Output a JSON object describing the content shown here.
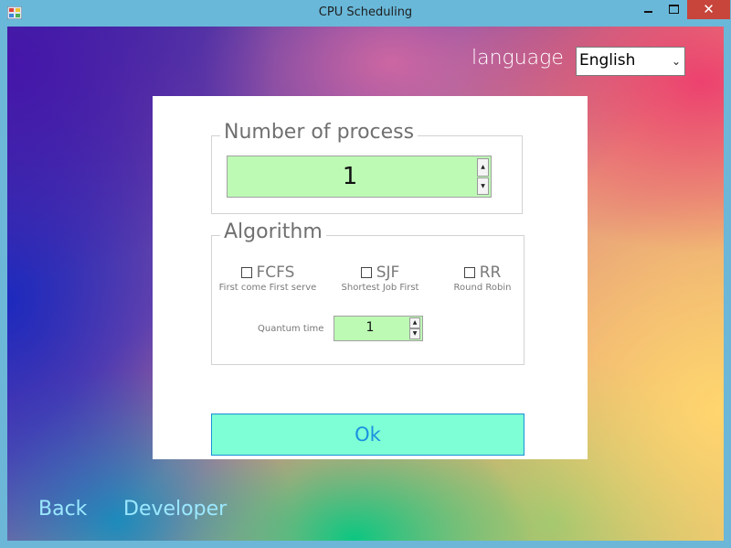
{
  "window": {
    "title": "CPU Scheduling",
    "close_glyph": "✕"
  },
  "language": {
    "label": "language",
    "selected": "English",
    "chevron": "⌄"
  },
  "process_group": {
    "legend": "Number of process",
    "value": "1"
  },
  "algorithm_group": {
    "legend": "Algorithm",
    "options": [
      {
        "name": "FCFS",
        "description": "First come First serve",
        "checked": false
      },
      {
        "name": "SJF",
        "description": "Shortest Job First",
        "checked": false
      },
      {
        "name": "RR",
        "description": "Round Robin",
        "checked": false
      }
    ],
    "quantum_label": "Quantum time",
    "quantum_value": "1"
  },
  "ok_label": "Ok",
  "footer": {
    "back_label": "Back",
    "developer_label": "Developer"
  },
  "colors": {
    "input_bg": "#bdfbb5",
    "ok_bg": "#7effd6",
    "ok_text": "#1a90e0",
    "link_text": "#9be8ff",
    "close_bg": "#c7453a"
  }
}
